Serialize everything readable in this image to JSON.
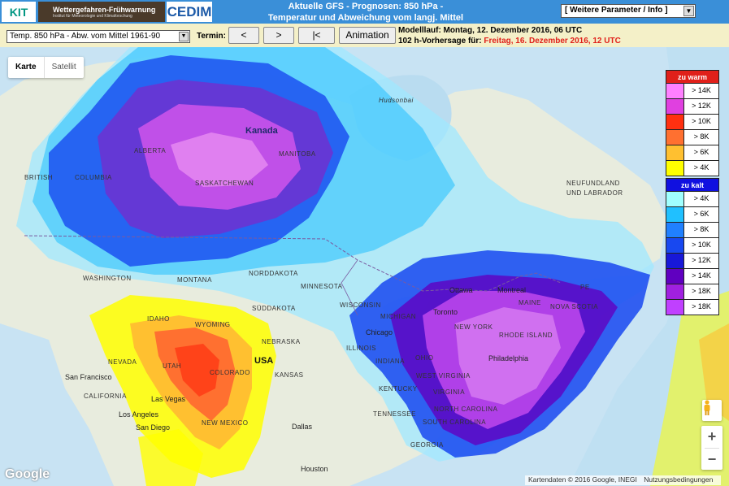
{
  "header": {
    "logo_kit": "KIT",
    "logo_wff_title": "Wettergefahren-Frühwarnung",
    "logo_wff_sub": "Institut für Meteorologie und Klimaforschung",
    "logo_cedim": "CEDIM",
    "title_line1": "Aktuelle GFS - Prognosen: 850 hPa -",
    "title_line2": "Temperatur und Abweichung vom langj. Mittel",
    "param_select": "[ Weitere Parameter / Info ]"
  },
  "toolbar": {
    "variable_select": "Temp. 850 hPa - Abw. vom Mittel 1961-90",
    "termin_label": "Termin:",
    "prev_label": "<",
    "next_label": ">",
    "first_label": "|<",
    "animation_label": "Animation",
    "modelllauf": "Modelllauf: Montag, 12. Dezember 2016, 06 UTC",
    "forecast_prefix": "102 h-Vorhersage für:",
    "forecast_date": "Freitag, 16. Dezember 2016, 12 UTC"
  },
  "map": {
    "maptype_map": "Karte",
    "maptype_satellite": "Satellit",
    "labels": {
      "kanada": "Kanada",
      "usa": "USA",
      "alberta": "ALBERTA",
      "manitoba": "MANITOBA",
      "saskatchewan": "SASKATCHEWAN",
      "bc1": "BRITISH",
      "bc2": "COLUMBIA",
      "washington": "WASHINGTON",
      "montana": "MONTANA",
      "norddakota": "NORDDAKOTA",
      "suddakota": "SÜDDAKOTA",
      "minnesota": "MINNESOTA",
      "wisconsin": "WISCONSIN",
      "michigan": "MICHIGAN",
      "idaho": "IDAHO",
      "wyoming": "WYOMING",
      "nebraska": "NEBRASKA",
      "kansas": "KANSAS",
      "colorado": "COLORADO",
      "nevada": "NEVADA",
      "utah": "UTAH",
      "newmexico": "NEW MEXICO",
      "california": "CALIFORNIA",
      "illinois": "ILLINOIS",
      "indiana": "INDIANA",
      "ohio": "OHIO",
      "kentucky": "KENTUCKY",
      "tennessee": "TENNESSEE",
      "virginia": "VIRGINIA",
      "westvirginia": "WEST VIRGINIA",
      "northcarolina": "NORTH CAROLINA",
      "southcarolina": "SOUTH CAROLINA",
      "georgia": "GEORGIA",
      "newyork": "NEW YORK",
      "maine": "MAINE",
      "novascotia": "NOVA SCOTIA",
      "rhodeisland": "RHODE ISLAND",
      "pe": "PE",
      "newfoundland1": "NEUFUNDLAND",
      "newfoundland2": "UND LABRADOR",
      "hudson": "Hudsonbai",
      "sanfrancisco": "San Francisco",
      "lasvegas": "Las Vegas",
      "losangeles": "Los Angeles",
      "sandiego": "San Diego",
      "chicago": "Chicago",
      "toronto": "Toronto",
      "ottawa": "Ottawa",
      "montreal": "Montreal",
      "philadelphia": "Philadelphia",
      "dallas": "Dallas",
      "houston": "Houston"
    },
    "google": "Google",
    "attribution": "Kartendaten © 2016 Google, INEGI",
    "terms": "Nutzungsbedingungen",
    "zoom_in": "+",
    "zoom_out": "−"
  },
  "legend": {
    "warm_title": "zu warm",
    "warm_color": "#e0201a",
    "warm": [
      {
        "label": "> 14K",
        "color": "#ff80ff"
      },
      {
        "label": "> 12K",
        "color": "#e040e0"
      },
      {
        "label": "> 10K",
        "color": "#ff3010"
      },
      {
        "label": "> 8K",
        "color": "#ff7030"
      },
      {
        "label": "> 6K",
        "color": "#ffc030"
      },
      {
        "label": "> 4K",
        "color": "#ffff00"
      }
    ],
    "cold_title": "zu kalt",
    "cold_color": "#1010e0",
    "cold": [
      {
        "label": "> 4K",
        "color": "#a0ffff"
      },
      {
        "label": "> 6K",
        "color": "#20c0ff"
      },
      {
        "label": "> 8K",
        "color": "#2080ff"
      },
      {
        "label": "> 10K",
        "color": "#1848f0"
      },
      {
        "label": "> 12K",
        "color": "#1818d8"
      },
      {
        "label": "> 14K",
        "color": "#6000c0"
      },
      {
        "label": "> 18K",
        "color": "#a020e0"
      },
      {
        "label": "> 18K",
        "color": "#c040ff"
      }
    ]
  }
}
